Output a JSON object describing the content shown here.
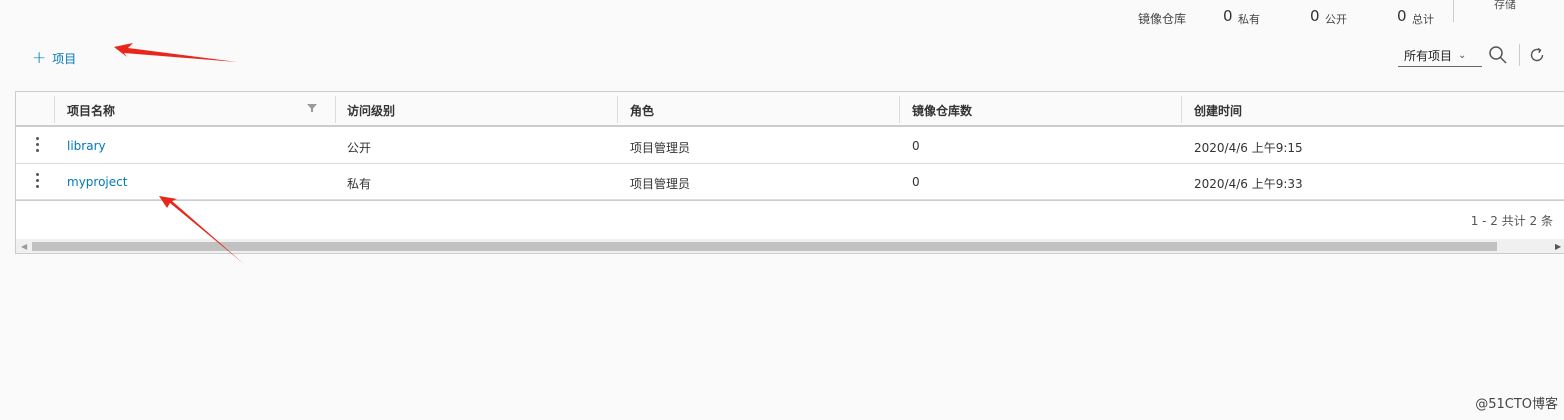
{
  "stats": {
    "repo_label": "镜像仓库",
    "private_count": "0",
    "private_label": "私有",
    "public_count": "0",
    "public_label": "公开",
    "total_count": "0",
    "total_label": "总计",
    "storage_label": "存储"
  },
  "toolbar": {
    "add_label": "项目",
    "filter_value": "所有项目"
  },
  "table": {
    "columns": [
      "项目名称",
      "访问级别",
      "角色",
      "镜像仓库数",
      "创建时间"
    ],
    "rows": [
      {
        "name": "library",
        "access": "公开",
        "role": "项目管理员",
        "repos": "0",
        "created": "2020/4/6 上午9:15"
      },
      {
        "name": "myproject",
        "access": "私有",
        "role": "项目管理员",
        "repos": "0",
        "created": "2020/4/6 上午9:33"
      }
    ],
    "footer": "1 - 2 共计 2 条"
  },
  "annotations": {
    "arrow_color": "#e8261a"
  },
  "watermark": "@51CTO博客"
}
